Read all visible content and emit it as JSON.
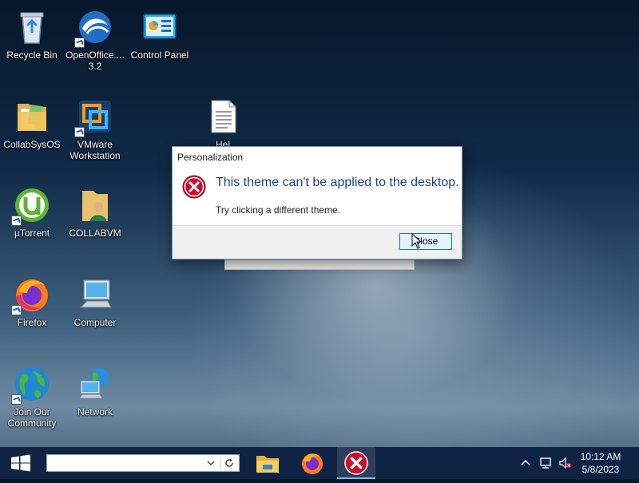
{
  "desktop": {
    "icons": [
      {
        "label": "Recycle Bin",
        "icon": "recycle-bin-icon"
      },
      {
        "label": "OpenOffice.... 3.2",
        "icon": "openoffice-icon"
      },
      {
        "label": "Control Panel",
        "icon": "control-panel-icon"
      },
      {
        "label": "CollabSysOS",
        "icon": "folder-icon"
      },
      {
        "label": "VMware Workstation",
        "icon": "vmware-icon"
      },
      {
        "label": "Hel",
        "icon": "text-document-icon"
      },
      {
        "label": "µTorrent",
        "icon": "utorrent-icon"
      },
      {
        "label": "COLLABVM",
        "icon": "user-folder-icon"
      },
      {
        "label": "Firefox",
        "icon": "firefox-icon"
      },
      {
        "label": "Computer",
        "icon": "computer-icon"
      },
      {
        "label": "Join Our Community",
        "icon": "globe-icon"
      },
      {
        "label": "Network",
        "icon": "network-icon"
      }
    ]
  },
  "dialog": {
    "title": "Personalization",
    "message": "This theme can't be applied to the desktop.",
    "detail": "Try clicking a different theme.",
    "close_label": "Close",
    "icon": "error-icon"
  },
  "taskbar": {
    "search_value": "",
    "apps": [
      {
        "name": "File Explorer",
        "icon": "file-explorer-icon"
      },
      {
        "name": "Firefox",
        "icon": "firefox-icon"
      },
      {
        "name": "Error",
        "icon": "error-icon",
        "active": true
      }
    ],
    "clock": {
      "time": "10:12 AM",
      "date": "5/8/2023"
    }
  },
  "colors": {
    "dialog_heading": "#1d3f8c",
    "taskbar": "#0f2444",
    "error_red": "#c8102e",
    "button_accent": "#0078d7"
  }
}
